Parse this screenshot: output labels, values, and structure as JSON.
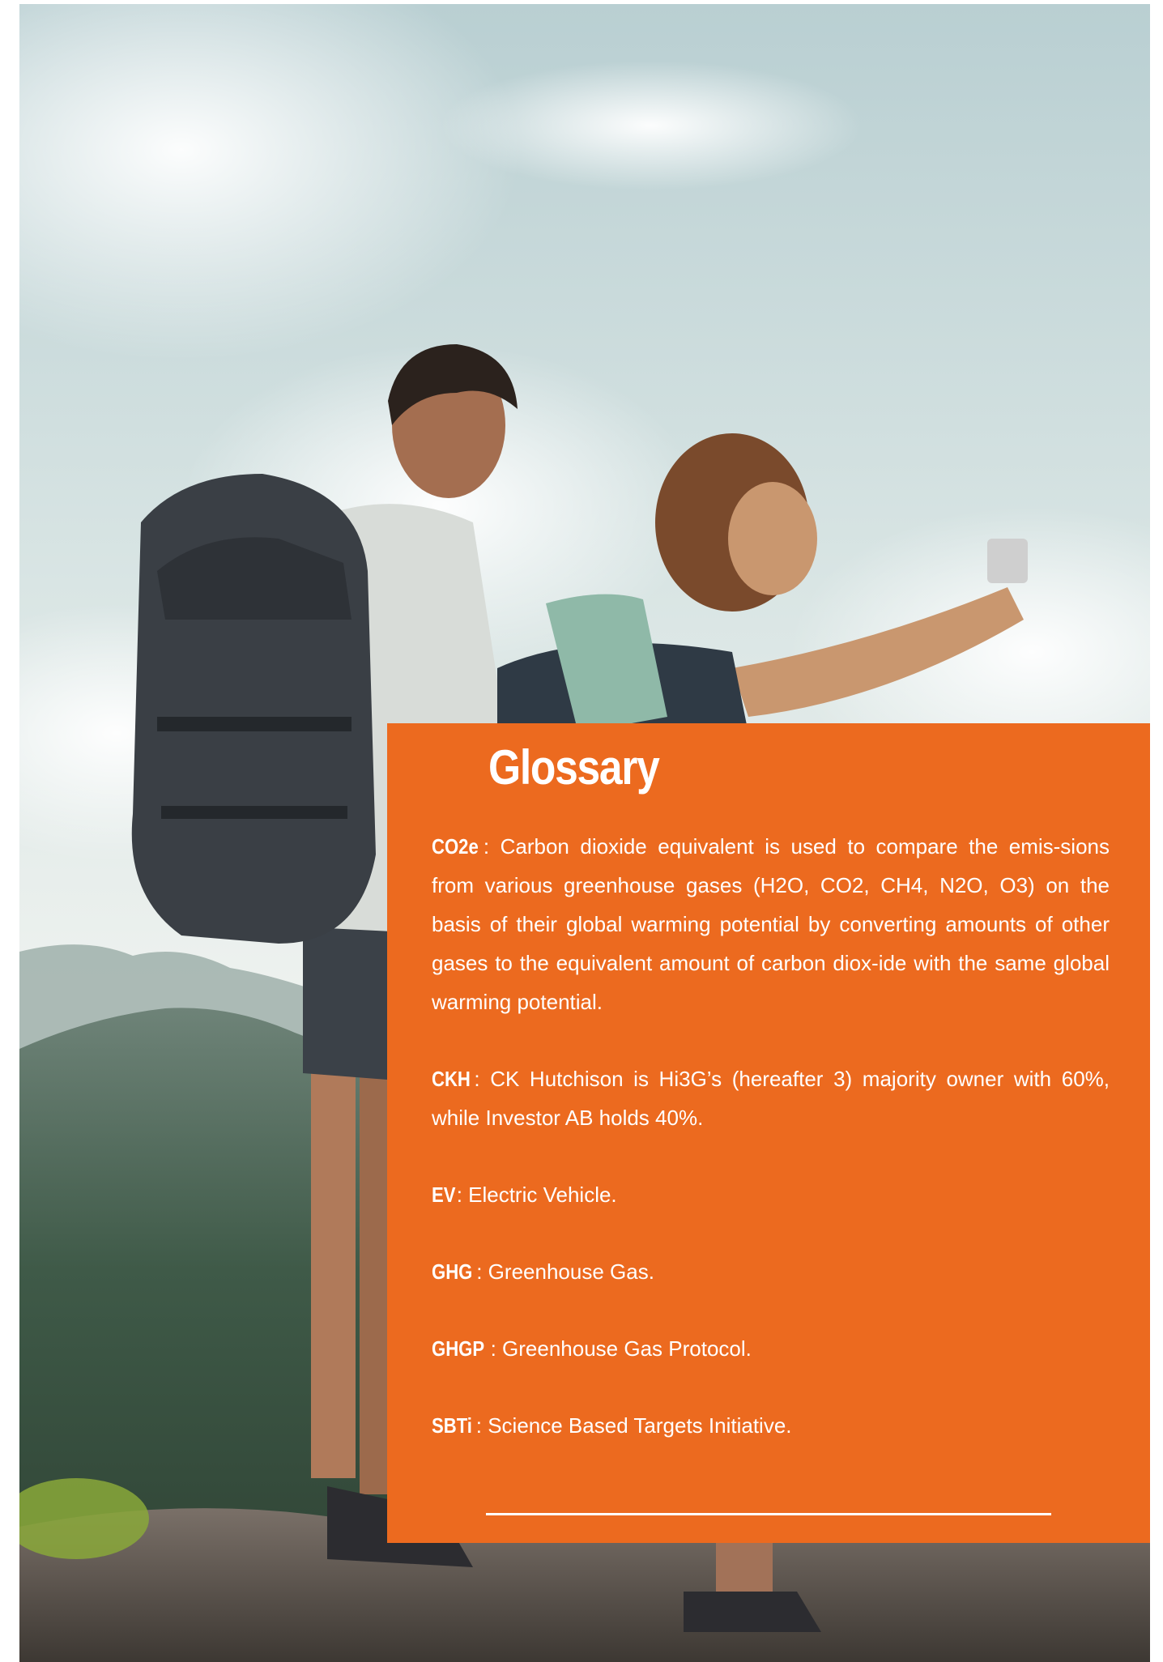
{
  "page": {
    "background_color": "#ffffff",
    "photo": {
      "description_icon": "hikers-on-mountain-photo",
      "sky_color": "#dbe6e6",
      "forest_color": "#3f5a48",
      "rock_color": "#5e5750"
    }
  },
  "glossary": {
    "title": "Glossary",
    "panel_color": "#ec6a1f",
    "entries": [
      {
        "term": "CO2e",
        "definition": ": Carbon dioxide equivalent is used to compare the emis-sions from various greenhouse gases (H2O, CO2, CH4, N2O, O3) on the basis of their global warming potential by converting amounts of other gases to the equivalent amount of carbon diox-ide with the same global warming potential."
      },
      {
        "term": "CKH",
        "definition": ": CK Hutchison is Hi3G’s (hereafter 3) majority owner with 60%, while Investor AB holds 40%."
      },
      {
        "term": "EV",
        "definition": ": Electric Vehicle."
      },
      {
        "term": "GHG",
        "definition": ": Greenhouse Gas."
      },
      {
        "term": "GHGP",
        "definition": ": Greenhouse Gas Protocol."
      },
      {
        "term": "SBTi",
        "definition": ": Science Based Targets Initiative."
      }
    ]
  }
}
